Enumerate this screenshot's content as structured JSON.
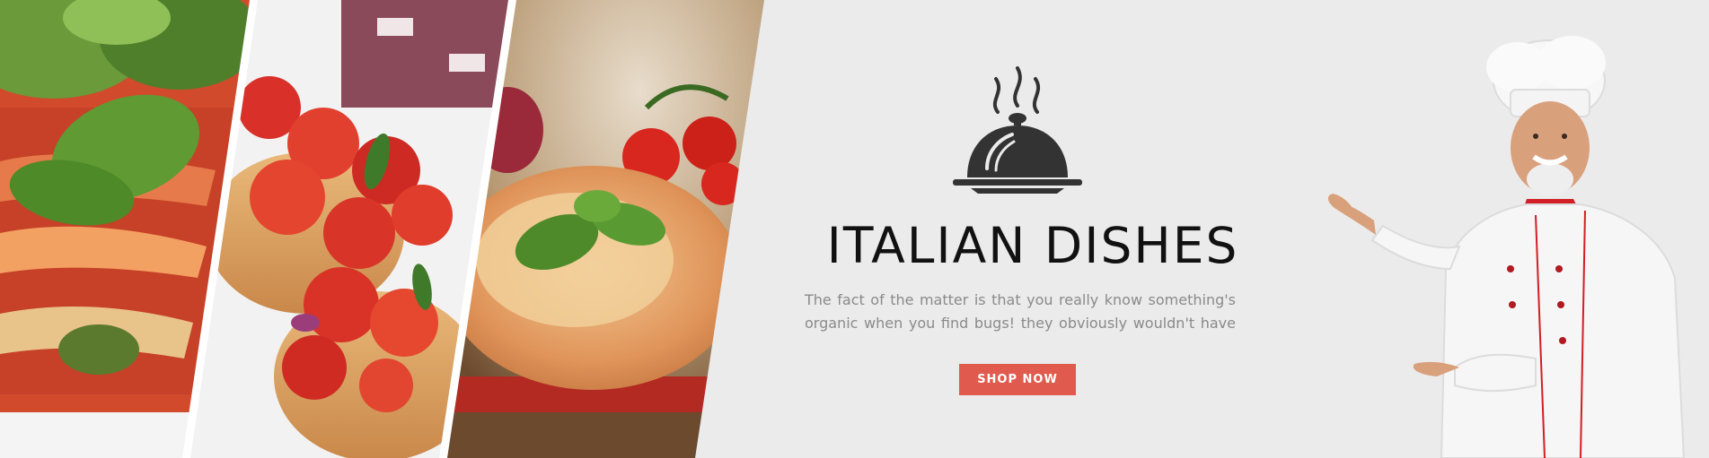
{
  "hero": {
    "title": "ITALIAN DISHES",
    "description": "The fact of the matter is that you really know something's organic when you find bugs! they obviously wouldn't have",
    "cta_label": "SHOP NOW"
  },
  "colors": {
    "background": "#ebebeb",
    "title": "#111111",
    "description": "#8a8a8a",
    "accent": "#e05a4d",
    "icon": "#333333"
  },
  "icons": {
    "hero_icon": "serving-cloche-icon"
  },
  "images": {
    "left_collage": [
      "lasagna-photo",
      "bruschetta-photo",
      "pizza-photo"
    ],
    "right": "chef-photo"
  }
}
